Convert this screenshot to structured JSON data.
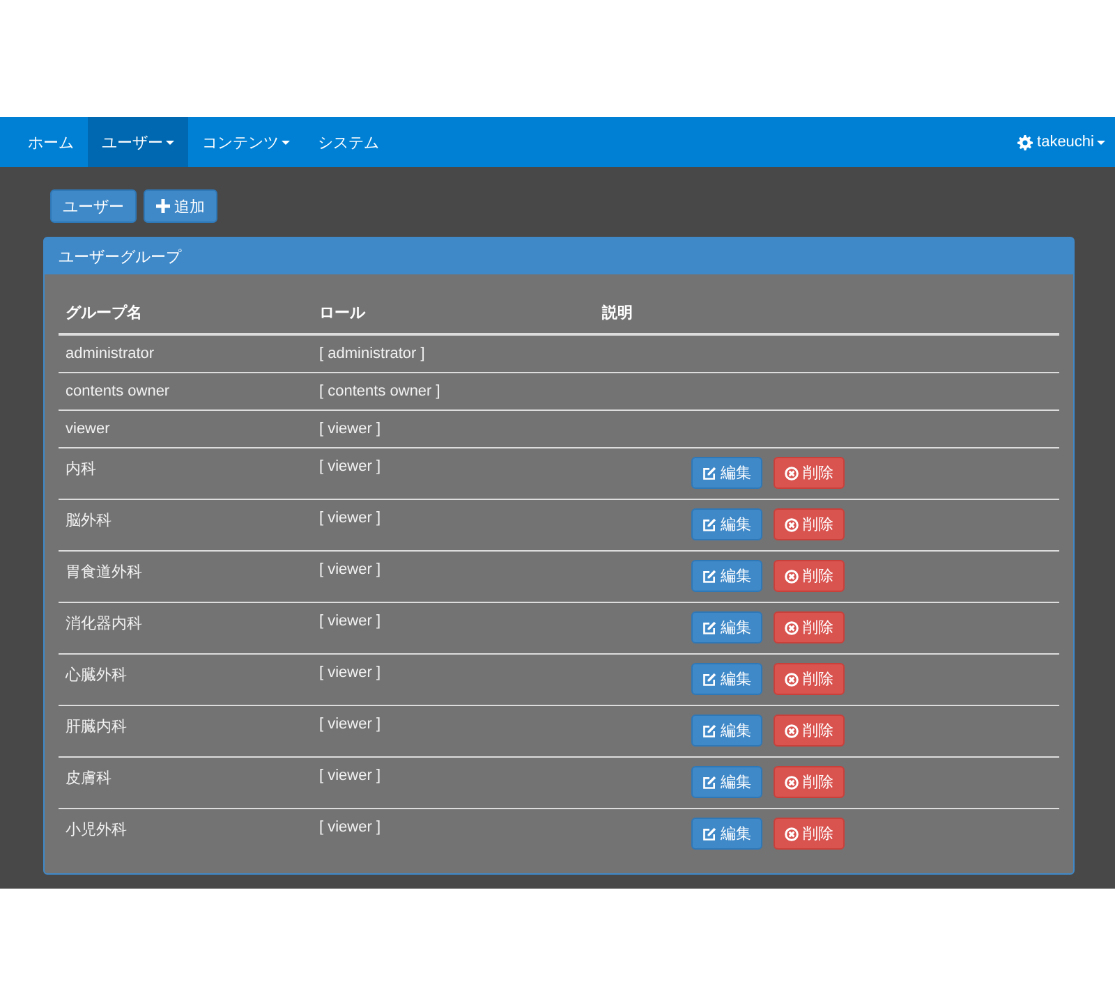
{
  "navbar": {
    "items": [
      {
        "label": "ホーム",
        "selected": false,
        "dropdown": false
      },
      {
        "label": "ユーザー",
        "selected": true,
        "dropdown": true
      },
      {
        "label": "コンテンツ",
        "selected": false,
        "dropdown": true
      },
      {
        "label": "システム",
        "selected": false,
        "dropdown": false
      }
    ],
    "user": {
      "label": "takeuchi",
      "dropdown": true
    }
  },
  "toolbar": [
    {
      "label": "ユーザー",
      "kind": "plain"
    },
    {
      "label": "追加",
      "kind": "add"
    }
  ],
  "panel": {
    "title": "ユーザーグループ",
    "table": {
      "columns": [
        "グループ名",
        "ロール",
        "説明"
      ],
      "rows": [
        {
          "name": "administrator",
          "role": "[ administrator ]"
        },
        {
          "name": "contents owner",
          "role": "[ contents owner ]"
        },
        {
          "name": "viewer",
          "role": "[ viewer ]"
        },
        {
          "name": "内科",
          "role": "[ viewer ]",
          "buttons": [
            {
              "label": "編集",
              "kind": "edit"
            },
            {
              "label": "削除",
              "kind": "delete"
            }
          ]
        },
        {
          "name": "脳外科",
          "role": "[ viewer ]",
          "buttons": [
            {
              "label": "編集",
              "kind": "edit"
            },
            {
              "label": "削除",
              "kind": "delete"
            }
          ]
        },
        {
          "name": "胃食道外科",
          "role": "[ viewer ]",
          "buttons": [
            {
              "label": "編集",
              "kind": "edit"
            },
            {
              "label": "削除",
              "kind": "delete"
            }
          ]
        },
        {
          "name": "消化器内科",
          "role": "[ viewer ]",
          "buttons": [
            {
              "label": "編集",
              "kind": "edit"
            },
            {
              "label": "削除",
              "kind": "delete"
            }
          ]
        },
        {
          "name": "心臓外科",
          "role": "[ viewer ]",
          "buttons": [
            {
              "label": "編集",
              "kind": "edit"
            },
            {
              "label": "削除",
              "kind": "delete"
            }
          ]
        },
        {
          "name": "肝臓内科",
          "role": "[ viewer ]",
          "buttons": [
            {
              "label": "編集",
              "kind": "edit"
            },
            {
              "label": "削除",
              "kind": "delete"
            }
          ]
        },
        {
          "name": "皮膚科",
          "role": "[ viewer ]",
          "buttons": [
            {
              "label": "編集",
              "kind": "edit"
            },
            {
              "label": "削除",
              "kind": "delete"
            }
          ]
        },
        {
          "name": "小児外科",
          "role": "[ viewer ]",
          "buttons": [
            {
              "label": "編集",
              "kind": "edit"
            },
            {
              "label": "削除",
              "kind": "delete"
            }
          ]
        }
      ]
    }
  }
}
